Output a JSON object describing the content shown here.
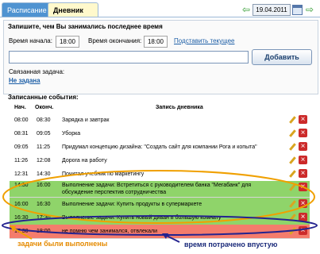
{
  "tabs": [
    {
      "label": "Расписание"
    },
    {
      "label": "Дневник"
    }
  ],
  "nav": {
    "prev": "⇦",
    "next": "⇨",
    "date": "19.04.2011"
  },
  "form": {
    "prompt": "Запишите, чем Вы занимались последнее время",
    "start_label": "Время начала:",
    "start_value": "18:00",
    "end_label": "Время окончания:",
    "end_value": "18:00",
    "current_link": "Подставить текущее",
    "entry_value": "",
    "add_button": "Добавить",
    "linked_task_label": "Связанная задача:",
    "linked_task_value": "Не задана"
  },
  "events": {
    "title": "Записанные события:",
    "headers": {
      "start": "Нач.",
      "end": "Оконч.",
      "text": "Запись дневника"
    },
    "rows": [
      {
        "start": "08:00",
        "end": "08:30",
        "text": "Зарядка и завтрак",
        "status": "normal"
      },
      {
        "start": "08:31",
        "end": "09:05",
        "text": "Уборка",
        "status": "normal"
      },
      {
        "start": "09:05",
        "end": "11:25",
        "text": "Придумал концепцию дизайна: \"Создать сайт для компании Рога и копыта\"",
        "status": "normal"
      },
      {
        "start": "11:26",
        "end": "12:08",
        "text": "Дорога на работу",
        "status": "normal"
      },
      {
        "start": "12:31",
        "end": "14:30",
        "text": "Почитал учебник по маркетингу",
        "status": "normal"
      },
      {
        "start": "14:30",
        "end": "16:00",
        "text": "Выполнение задачи: Встретиться с руководителем банка \"Мегабанк\" для обсуждение перспектив сотрудничества",
        "status": "done"
      },
      {
        "start": "16:00",
        "end": "16:30",
        "text": "Выполнение задачи: Купить продукты в супермаркете",
        "status": "done"
      },
      {
        "start": "16:30",
        "end": "17:30",
        "text": "Выполнение задачи: Купить новый диван в большую комнату",
        "status": "done"
      },
      {
        "start": "17:30",
        "end": "18:00",
        "text": "не помню чем занимался, отвлекали",
        "status": "wasted"
      }
    ]
  },
  "annotations": {
    "done": "задачи были выполнены",
    "wasted": "время потрачено впустую"
  },
  "colors": {
    "done_bg": "#8fd46a",
    "wasted_bg": "#f47c6c",
    "done_outline": "#f0a000",
    "wasted_outline": "#24238f"
  },
  "icons": {
    "edit": "pencil-icon",
    "delete": "delete-x-icon",
    "calendar": "calendar-icon"
  }
}
